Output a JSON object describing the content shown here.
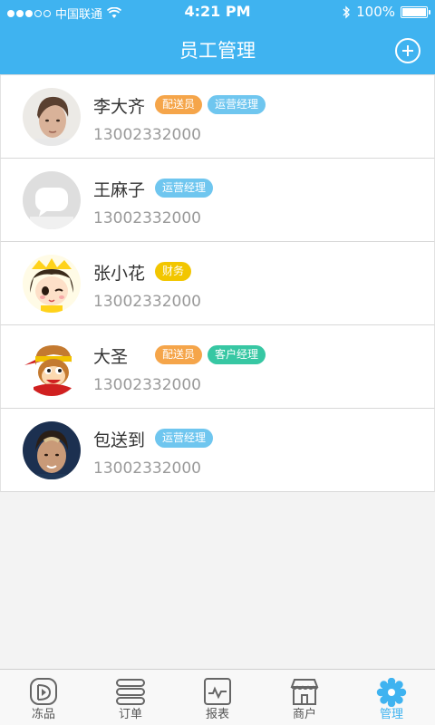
{
  "status_bar": {
    "carrier": "中国联通",
    "time": "4:21 PM",
    "battery": "100%",
    "signal_icon": "signal-dots-icon",
    "wifi_icon": "wifi-icon",
    "bluetooth_icon": "bluetooth-icon",
    "battery_icon": "battery-icon"
  },
  "nav": {
    "title": "员工管理",
    "add_icon": "plus-circle-icon"
  },
  "colors": {
    "accent": "#3fb3f0",
    "tag_delivery": "#f5a54a",
    "tag_operations": "#6fc6ef",
    "tag_finance": "#f2c600",
    "tag_customer": "#37c7a3"
  },
  "staff": [
    {
      "name": "李大齐",
      "phone": "13002332000",
      "avatar": "male-portrait-avatar",
      "tags": [
        {
          "label": "配送员",
          "color": "#f5a54a"
        },
        {
          "label": "运营经理",
          "color": "#6fc6ef"
        }
      ]
    },
    {
      "name": "王麻子",
      "phone": "13002332000",
      "avatar": "default-user-avatar",
      "tags": [
        {
          "label": "运营经理",
          "color": "#6fc6ef"
        }
      ]
    },
    {
      "name": "张小花",
      "phone": "13002332000",
      "avatar": "cartoon-girl-avatar",
      "tags": [
        {
          "label": "财务",
          "color": "#f2c600"
        }
      ]
    },
    {
      "name": "大圣",
      "phone": "13002332000",
      "avatar": "cartoon-monkey-avatar",
      "tags": [
        {
          "label": "配送员",
          "color": "#f5a54a"
        },
        {
          "label": "客户经理",
          "color": "#37c7a3"
        }
      ]
    },
    {
      "name": "包送到",
      "phone": "13002332000",
      "avatar": "male-portrait-avatar-2",
      "tags": [
        {
          "label": "运营经理",
          "color": "#6fc6ef"
        }
      ]
    }
  ],
  "tabbar": [
    {
      "label": "冻品",
      "icon": "frozen-goods-icon",
      "active": false
    },
    {
      "label": "订单",
      "icon": "orders-list-icon",
      "active": false
    },
    {
      "label": "报表",
      "icon": "report-chart-icon",
      "active": false
    },
    {
      "label": "商户",
      "icon": "storefront-icon",
      "active": false
    },
    {
      "label": "管理",
      "icon": "manage-gear-icon",
      "active": true
    }
  ]
}
